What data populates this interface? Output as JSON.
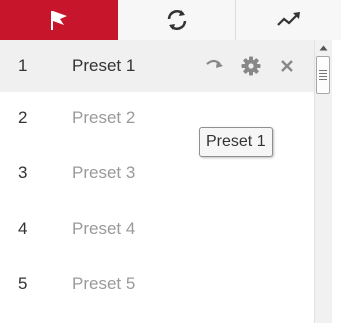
{
  "tabs": [
    {
      "icon": "flag-icon",
      "active": true
    },
    {
      "icon": "refresh-cycle-icon",
      "active": false
    },
    {
      "icon": "trend-line-icon",
      "active": false
    }
  ],
  "accent_color": "#c7152b",
  "presets": [
    {
      "number": "1",
      "name": "Preset 1",
      "selected": true
    },
    {
      "number": "2",
      "name": "Preset 2",
      "selected": false
    },
    {
      "number": "3",
      "name": "Preset 3",
      "selected": false
    },
    {
      "number": "4",
      "name": "Preset 4",
      "selected": false
    },
    {
      "number": "5",
      "name": "Preset 5",
      "selected": false
    }
  ],
  "row_actions": [
    "goto-icon",
    "gear-icon",
    "close-icon"
  ],
  "tooltip": {
    "text": "Preset 1"
  }
}
